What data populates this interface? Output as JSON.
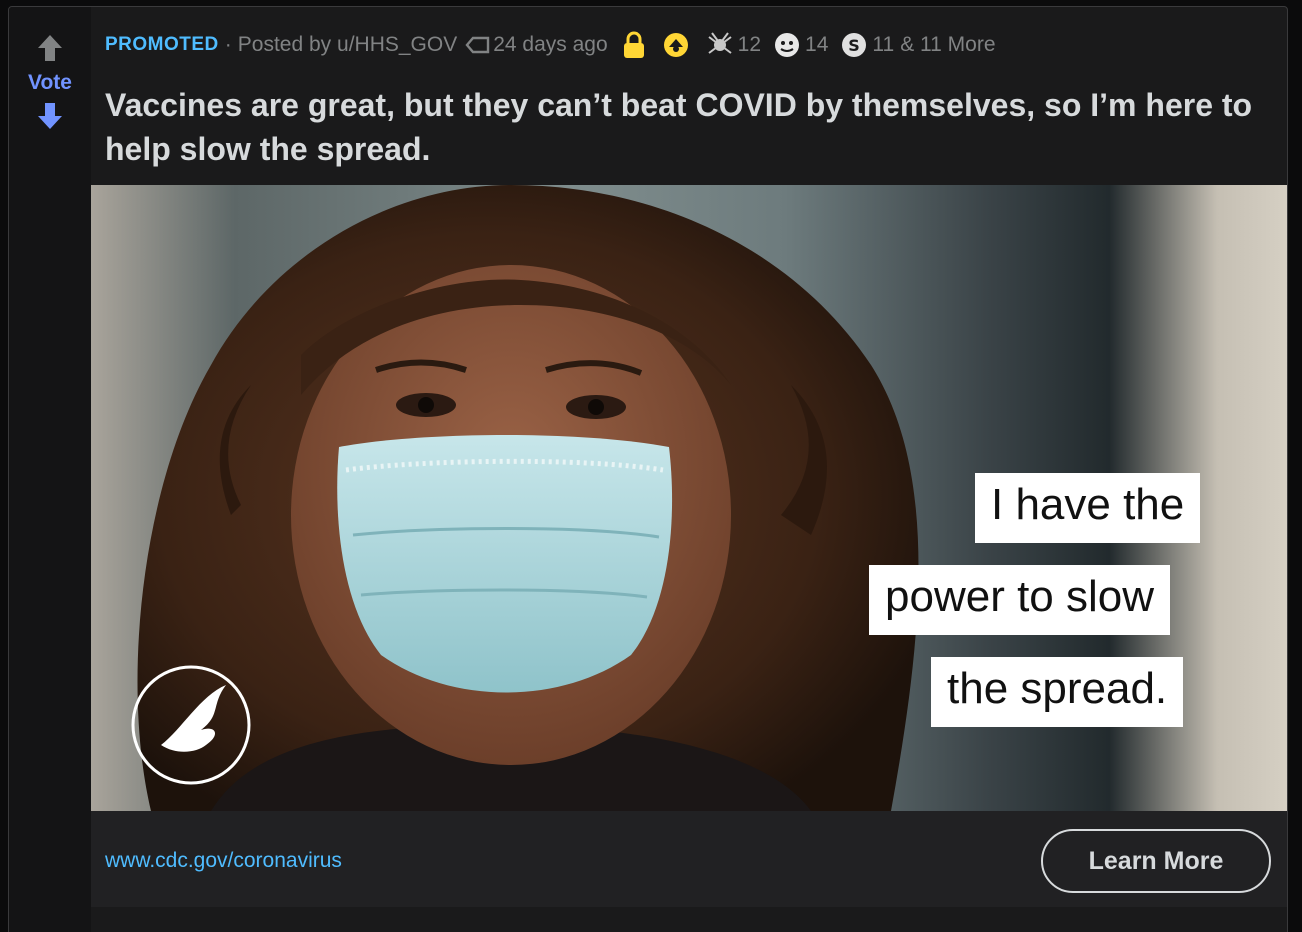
{
  "vote": {
    "label": "Vote"
  },
  "meta": {
    "promoted": "PROMOTED",
    "separator": "·",
    "posted_by": "Posted by u/HHS_GOV",
    "time_ago": "24 days ago",
    "awards": [
      {
        "icon": "spider-award-icon",
        "count": "12"
      },
      {
        "icon": "hugz-award-icon",
        "count": "14"
      },
      {
        "icon": "silver-s-award-icon",
        "count": "11"
      }
    ],
    "more_awards": "& 11 More"
  },
  "post": {
    "title": "Vaccines are great, but they can’t beat COVID by themselves, so I’m here to help slow the spread."
  },
  "media": {
    "captions": [
      "I have the",
      "power to slow",
      "the spread."
    ]
  },
  "link": {
    "url": "www.cdc.gov/coronavirus",
    "cta": "Learn More"
  },
  "colors": {
    "accent_blue": "#4fbcff",
    "vote_blue": "#7193ff",
    "card_bg": "#1a1a1b",
    "lock_yellow": "#ffd635"
  }
}
